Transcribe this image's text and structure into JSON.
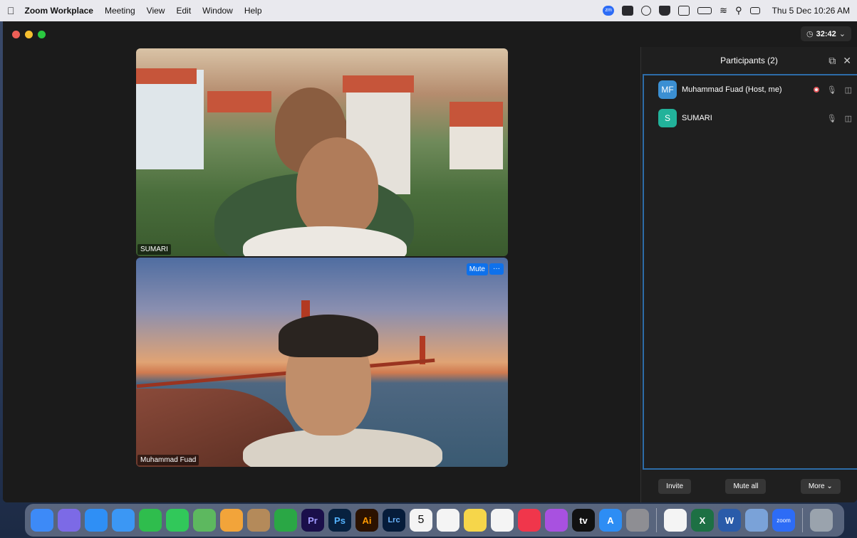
{
  "menubar": {
    "app_name": "Zoom Workplace",
    "menus": [
      "Meeting",
      "View",
      "Edit",
      "Window",
      "Help"
    ],
    "tray": {
      "zoom_icon_text": "zm"
    },
    "clock": "Thu 5 Dec  10:26 AM"
  },
  "window": {
    "traffic_lights": [
      "#ed5f57",
      "#f5bf2f",
      "#2ac840"
    ],
    "timer": "32:42"
  },
  "videos": [
    {
      "name": "SUMARI"
    },
    {
      "name": "Muhammad Fuad",
      "mute_label": "Mute",
      "more_label": "···"
    }
  ],
  "panel": {
    "title": "Participants (2)",
    "participants": [
      {
        "initials": "MF",
        "name": "Muhammad Fuad (Host, me)",
        "avatar_color": "#3b8fd2"
      },
      {
        "initials": "S",
        "name": "SUMARI",
        "avatar_color": "#22b29a"
      }
    ],
    "footer": {
      "invite": "Invite",
      "mute_all": "Mute all",
      "more": "More"
    }
  },
  "dock": {
    "icons": [
      {
        "name": "finder-icon",
        "color": "#3d8af7",
        "label": ""
      },
      {
        "name": "launchpad-icon",
        "color": "#7c6ae6",
        "label": ""
      },
      {
        "name": "safari-icon",
        "color": "#2f8ff5",
        "label": ""
      },
      {
        "name": "mail-icon",
        "color": "#3b97f4",
        "label": ""
      },
      {
        "name": "facetime-icon",
        "color": "#2fbd4d",
        "label": ""
      },
      {
        "name": "messages-icon",
        "color": "#31c85a",
        "label": ""
      },
      {
        "name": "maps-icon",
        "color": "#5db85f",
        "label": ""
      },
      {
        "name": "photos-icon",
        "color": "#f2a43a",
        "label": ""
      },
      {
        "name": "contacts-icon",
        "color": "#b48a5a",
        "label": ""
      },
      {
        "name": "numbers-icon",
        "color": "#2aa745",
        "label": ""
      },
      {
        "name": "premiere-icon",
        "color": "#1a0f4a",
        "label": "Pr"
      },
      {
        "name": "photoshop-icon",
        "color": "#07213f",
        "label": "Ps"
      },
      {
        "name": "illustrator-icon",
        "color": "#2b1200",
        "label": "Ai"
      },
      {
        "name": "lightroom-classic-icon",
        "color": "#061c3a",
        "label": "Lrc"
      },
      {
        "name": "calendar-icon",
        "color": "#f4f4f4",
        "label": "5"
      },
      {
        "name": "reminders-icon",
        "color": "#f4f4f4",
        "label": ""
      },
      {
        "name": "notes-icon",
        "color": "#f6d64a",
        "label": ""
      },
      {
        "name": "freeform-icon",
        "color": "#f4f4f4",
        "label": ""
      },
      {
        "name": "music-icon",
        "color": "#f0364b",
        "label": ""
      },
      {
        "name": "podcasts-icon",
        "color": "#a851e0",
        "label": ""
      },
      {
        "name": "apple-tv-icon",
        "color": "#111111",
        "label": "tv"
      },
      {
        "name": "app-store-icon",
        "color": "#2d8df4",
        "label": "A"
      },
      {
        "name": "system-settings-icon",
        "color": "#8e8e93",
        "label": ""
      },
      {
        "name": "chrome-icon",
        "color": "#f4f4f4",
        "label": ""
      },
      {
        "name": "excel-icon",
        "color": "#1d7044",
        "label": "X"
      },
      {
        "name": "word-icon",
        "color": "#2a5ba9",
        "label": "W"
      },
      {
        "name": "preview-icon",
        "color": "#7aa2d8",
        "label": ""
      },
      {
        "name": "zoom-icon",
        "color": "#2d6cf6",
        "label": "zoom"
      },
      {
        "name": "trash-icon",
        "color": "#9aa3ad",
        "label": ""
      }
    ]
  }
}
